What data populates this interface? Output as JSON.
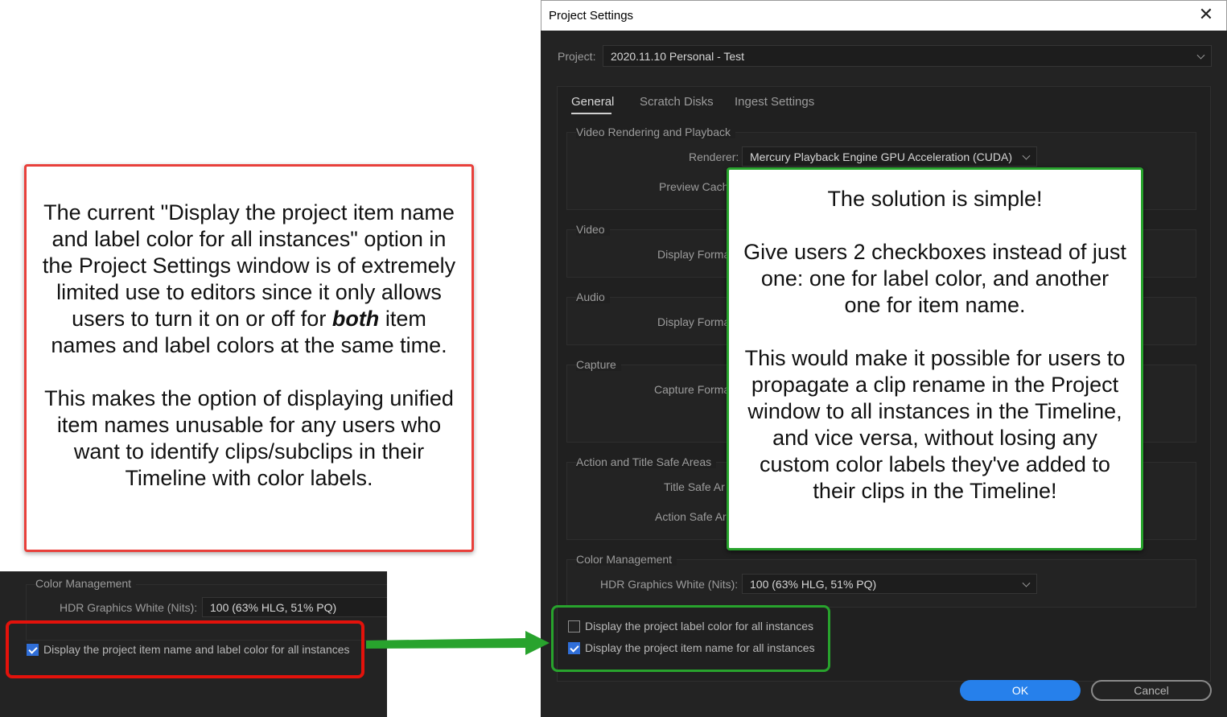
{
  "dialog": {
    "title": "Project Settings",
    "project_label": "Project:",
    "project_value": "2020.11.10 Personal - Test",
    "tabs": [
      {
        "label": "General",
        "active": true
      },
      {
        "label": "Scratch Disks",
        "active": false
      },
      {
        "label": "Ingest Settings",
        "active": false
      }
    ],
    "groups": {
      "video_rendering": {
        "legend": "Video Rendering and Playback",
        "renderer_label": "Renderer:",
        "renderer_value": "Mercury Playback Engine GPU Acceleration (CUDA)",
        "preview_label": "Preview Cach"
      },
      "video": {
        "legend": "Video",
        "display_label": "Display Forma"
      },
      "audio": {
        "legend": "Audio",
        "display_label": "Display Forma"
      },
      "capture": {
        "legend": "Capture",
        "capture_label": "Capture Forma"
      },
      "safe_areas": {
        "legend": "Action and Title Safe Areas",
        "title_label": "Title Safe Ar",
        "action_label": "Action Safe Ar"
      },
      "color_mgmt": {
        "legend": "Color Management",
        "hdr_label": "HDR Graphics White (Nits):",
        "hdr_value": "100 (63% HLG, 51% PQ)"
      }
    },
    "checkboxes": [
      {
        "label": "Display the project label color for all instances",
        "checked": false
      },
      {
        "label": "Display the project item name for all instances",
        "checked": true
      }
    ],
    "ok_label": "OK",
    "cancel_label": "Cancel"
  },
  "green_note": {
    "p1": "The solution is simple!",
    "p2": "Give users 2 checkboxes instead of just one: one for label color, and another one for item name.",
    "p3": "This would make it possible for users to propagate a clip rename in the Project window to all instances in the Timeline, and vice versa, without losing any custom color labels they've added to their clips in the Timeline!"
  },
  "red_note": {
    "p1_a": "The current \"Display the project item name and label color for all instances\" option in the Project Settings window is of extremely limited use to editors since it only allows users to turn it on or off for ",
    "p1_em": "both",
    "p1_b": " item names and label colors at the same time.",
    "p2": "This makes the option of displaying unified item names unusable for any users who want to identify clips/subclips in their Timeline with color labels."
  },
  "snippet": {
    "legend": "Color Management",
    "hdr_label": "HDR Graphics White (Nits):",
    "hdr_value": "100 (63% HLG, 51% PQ)",
    "checkbox_label": "Display the project item name and label color for all instances",
    "checkbox_checked": true
  },
  "colors": {
    "red_annotation": "#e3120b",
    "green_annotation": "#28a32d",
    "ok_button": "#2680eb",
    "checkbox_checked": "#2f6ed8"
  }
}
